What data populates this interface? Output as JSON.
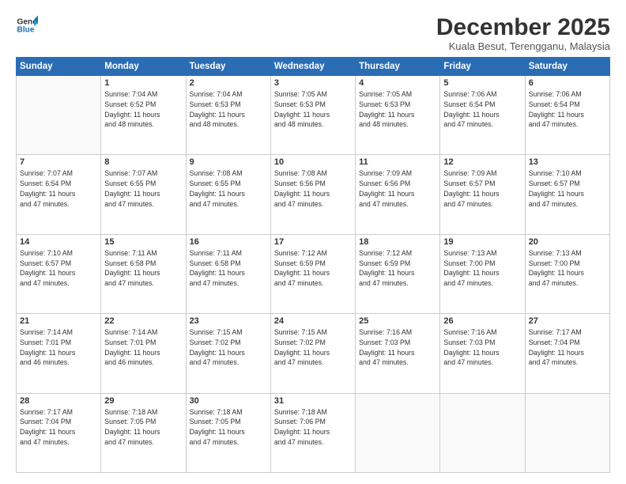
{
  "logo": {
    "line1": "General",
    "line2": "Blue"
  },
  "title": "December 2025",
  "subtitle": "Kuala Besut, Terengganu, Malaysia",
  "header_days": [
    "Sunday",
    "Monday",
    "Tuesday",
    "Wednesday",
    "Thursday",
    "Friday",
    "Saturday"
  ],
  "weeks": [
    [
      {
        "day": "",
        "info": ""
      },
      {
        "day": "1",
        "info": "Sunrise: 7:04 AM\nSunset: 6:52 PM\nDaylight: 11 hours\nand 48 minutes."
      },
      {
        "day": "2",
        "info": "Sunrise: 7:04 AM\nSunset: 6:53 PM\nDaylight: 11 hours\nand 48 minutes."
      },
      {
        "day": "3",
        "info": "Sunrise: 7:05 AM\nSunset: 6:53 PM\nDaylight: 11 hours\nand 48 minutes."
      },
      {
        "day": "4",
        "info": "Sunrise: 7:05 AM\nSunset: 6:53 PM\nDaylight: 11 hours\nand 48 minutes."
      },
      {
        "day": "5",
        "info": "Sunrise: 7:06 AM\nSunset: 6:54 PM\nDaylight: 11 hours\nand 47 minutes."
      },
      {
        "day": "6",
        "info": "Sunrise: 7:06 AM\nSunset: 6:54 PM\nDaylight: 11 hours\nand 47 minutes."
      }
    ],
    [
      {
        "day": "7",
        "info": "Sunrise: 7:07 AM\nSunset: 6:54 PM\nDaylight: 11 hours\nand 47 minutes."
      },
      {
        "day": "8",
        "info": "Sunrise: 7:07 AM\nSunset: 6:55 PM\nDaylight: 11 hours\nand 47 minutes."
      },
      {
        "day": "9",
        "info": "Sunrise: 7:08 AM\nSunset: 6:55 PM\nDaylight: 11 hours\nand 47 minutes."
      },
      {
        "day": "10",
        "info": "Sunrise: 7:08 AM\nSunset: 6:56 PM\nDaylight: 11 hours\nand 47 minutes."
      },
      {
        "day": "11",
        "info": "Sunrise: 7:09 AM\nSunset: 6:56 PM\nDaylight: 11 hours\nand 47 minutes."
      },
      {
        "day": "12",
        "info": "Sunrise: 7:09 AM\nSunset: 6:57 PM\nDaylight: 11 hours\nand 47 minutes."
      },
      {
        "day": "13",
        "info": "Sunrise: 7:10 AM\nSunset: 6:57 PM\nDaylight: 11 hours\nand 47 minutes."
      }
    ],
    [
      {
        "day": "14",
        "info": "Sunrise: 7:10 AM\nSunset: 6:57 PM\nDaylight: 11 hours\nand 47 minutes."
      },
      {
        "day": "15",
        "info": "Sunrise: 7:11 AM\nSunset: 6:58 PM\nDaylight: 11 hours\nand 47 minutes."
      },
      {
        "day": "16",
        "info": "Sunrise: 7:11 AM\nSunset: 6:58 PM\nDaylight: 11 hours\nand 47 minutes."
      },
      {
        "day": "17",
        "info": "Sunrise: 7:12 AM\nSunset: 6:59 PM\nDaylight: 11 hours\nand 47 minutes."
      },
      {
        "day": "18",
        "info": "Sunrise: 7:12 AM\nSunset: 6:59 PM\nDaylight: 11 hours\nand 47 minutes."
      },
      {
        "day": "19",
        "info": "Sunrise: 7:13 AM\nSunset: 7:00 PM\nDaylight: 11 hours\nand 47 minutes."
      },
      {
        "day": "20",
        "info": "Sunrise: 7:13 AM\nSunset: 7:00 PM\nDaylight: 11 hours\nand 47 minutes."
      }
    ],
    [
      {
        "day": "21",
        "info": "Sunrise: 7:14 AM\nSunset: 7:01 PM\nDaylight: 11 hours\nand 46 minutes."
      },
      {
        "day": "22",
        "info": "Sunrise: 7:14 AM\nSunset: 7:01 PM\nDaylight: 11 hours\nand 46 minutes."
      },
      {
        "day": "23",
        "info": "Sunrise: 7:15 AM\nSunset: 7:02 PM\nDaylight: 11 hours\nand 47 minutes."
      },
      {
        "day": "24",
        "info": "Sunrise: 7:15 AM\nSunset: 7:02 PM\nDaylight: 11 hours\nand 47 minutes."
      },
      {
        "day": "25",
        "info": "Sunrise: 7:16 AM\nSunset: 7:03 PM\nDaylight: 11 hours\nand 47 minutes."
      },
      {
        "day": "26",
        "info": "Sunrise: 7:16 AM\nSunset: 7:03 PM\nDaylight: 11 hours\nand 47 minutes."
      },
      {
        "day": "27",
        "info": "Sunrise: 7:17 AM\nSunset: 7:04 PM\nDaylight: 11 hours\nand 47 minutes."
      }
    ],
    [
      {
        "day": "28",
        "info": "Sunrise: 7:17 AM\nSunset: 7:04 PM\nDaylight: 11 hours\nand 47 minutes."
      },
      {
        "day": "29",
        "info": "Sunrise: 7:18 AM\nSunset: 7:05 PM\nDaylight: 11 hours\nand 47 minutes."
      },
      {
        "day": "30",
        "info": "Sunrise: 7:18 AM\nSunset: 7:05 PM\nDaylight: 11 hours\nand 47 minutes."
      },
      {
        "day": "31",
        "info": "Sunrise: 7:18 AM\nSunset: 7:06 PM\nDaylight: 11 hours\nand 47 minutes."
      },
      {
        "day": "",
        "info": ""
      },
      {
        "day": "",
        "info": ""
      },
      {
        "day": "",
        "info": ""
      }
    ]
  ]
}
